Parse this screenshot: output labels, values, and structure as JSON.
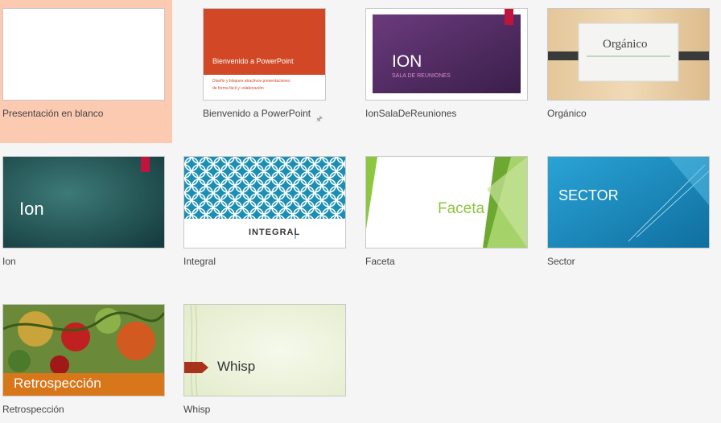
{
  "templates": [
    {
      "label": "Presentación en blanco"
    },
    {
      "label": "Bienvenido a PowerPoint",
      "thumb_title": "Bienvenido a PowerPoint",
      "thumb_sub1": "Diseño y bloques atractivos presentaciones",
      "thumb_sub2": "de forma fácil y colaboración"
    },
    {
      "label": "IonSalaDeReuniones",
      "thumb_title": "ION",
      "thumb_sub": "SALA DE REUNIONES"
    },
    {
      "label": "Orgánico",
      "thumb_title": "Orgánico"
    },
    {
      "label": "Ion",
      "thumb_title": "Ion"
    },
    {
      "label": "Integral",
      "thumb_title": "INTEGRAL"
    },
    {
      "label": "Faceta",
      "thumb_title": "Faceta"
    },
    {
      "label": "Sector",
      "thumb_title": "SECTOR"
    },
    {
      "label": "Retrospección",
      "thumb_title": "Retrospección"
    },
    {
      "label": "Whisp",
      "thumb_title": "Whisp"
    }
  ],
  "colors": {
    "selection": "#fcc9b1",
    "powerpoint_orange": "#d24726",
    "ion_purple": "#4e2a5e",
    "ion_teal": "#1d4d4f",
    "accent_red": "#c0143c",
    "integral_teal": "#1b8fb3",
    "faceta_green": "#8dc63f",
    "sector_blue": "#1d8fc4",
    "retro_orange": "#d8761a",
    "whisp_red": "#a8321a"
  },
  "icons": {
    "pin": "pin-icon"
  }
}
